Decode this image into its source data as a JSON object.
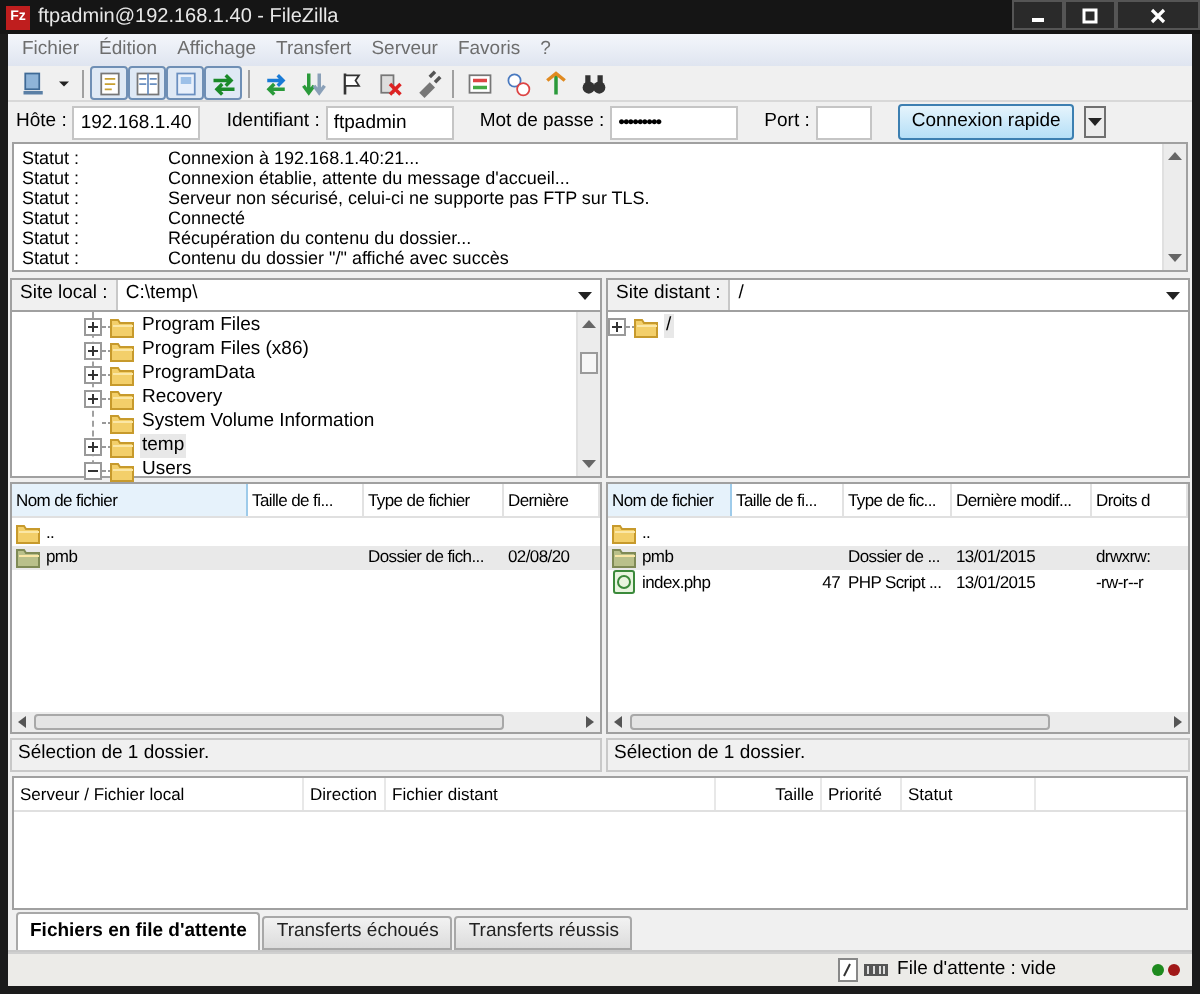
{
  "window": {
    "title": "ftpadmin@192.168.1.40 - FileZilla",
    "logo_text": "Fz"
  },
  "menu": [
    "Fichier",
    "Édition",
    "Affichage",
    "Transfert",
    "Serveur",
    "Favoris",
    "?"
  ],
  "toolbar": {
    "groups": [
      [
        {
          "kind": "site-manager",
          "on": false
        },
        {
          "kind": "caret",
          "on": false
        }
      ],
      [
        {
          "kind": "log",
          "on": true
        },
        {
          "kind": "local-tree",
          "on": true
        },
        {
          "kind": "remote-tree",
          "on": true
        },
        {
          "kind": "queue",
          "on": true
        }
      ],
      [
        {
          "kind": "refresh",
          "on": false
        },
        {
          "kind": "process",
          "on": false
        },
        {
          "kind": "cancel",
          "on": false
        },
        {
          "kind": "disconnect",
          "on": false
        },
        {
          "kind": "reconnect",
          "on": false
        }
      ],
      [
        {
          "kind": "filter",
          "on": false
        },
        {
          "kind": "compare",
          "on": false
        },
        {
          "kind": "sync",
          "on": false
        },
        {
          "kind": "search",
          "on": false
        }
      ]
    ]
  },
  "quickconnect": {
    "fields": [
      {
        "label": "Hôte :",
        "value": "192.168.1.40",
        "kind": "text"
      },
      {
        "label": "Identifiant :",
        "value": "ftpadmin",
        "kind": "text"
      },
      {
        "label": "Mot de passe :",
        "value": "•••••••••",
        "kind": "password"
      },
      {
        "label": "Port :",
        "kind": "port"
      }
    ],
    "button": "Connexion rapide"
  },
  "log": [
    {
      "label": "Statut :",
      "message": "Connexion à 192.168.1.40:21..."
    },
    {
      "label": "Statut :",
      "message": "Connexion établie, attente du message d'accueil..."
    },
    {
      "label": "Statut :",
      "message": "Serveur non sécurisé, celui-ci ne supporte pas FTP sur TLS."
    },
    {
      "label": "Statut :",
      "message": "Connecté"
    },
    {
      "label": "Statut :",
      "message": "Récupération du contenu du dossier..."
    },
    {
      "label": "Statut :",
      "message": "Contenu du dossier \"/\" affiché avec succès"
    }
  ],
  "local": {
    "site_label": "Site local :",
    "path": "C:\\temp\\",
    "tree": [
      {
        "label": "Program Files",
        "has_children": true,
        "expanded": false,
        "selected": false
      },
      {
        "label": "Program Files (x86)",
        "has_children": true,
        "expanded": false,
        "selected": false
      },
      {
        "label": "ProgramData",
        "has_children": true,
        "expanded": false,
        "selected": false
      },
      {
        "label": "Recovery",
        "has_children": true,
        "expanded": false,
        "selected": false
      },
      {
        "label": "System Volume Information",
        "has_children": false,
        "selected": false
      },
      {
        "label": "temp",
        "has_children": true,
        "expanded": false,
        "selected": true
      },
      {
        "label": "Users",
        "has_children": true,
        "expanded": true,
        "selected": false
      }
    ],
    "columns": [
      "Nom de fichier",
      "Taille de fi...",
      "Type de fichier",
      "Dernière"
    ],
    "rows": [
      {
        "kind": "parent",
        "cells": [
          ".."
        ],
        "selected": false
      },
      {
        "kind": "folder",
        "cells": [
          "pmb",
          "",
          "Dossier de fich...",
          "02/08/20"
        ],
        "selected": true
      }
    ],
    "status": "Sélection de 1 dossier."
  },
  "remote": {
    "site_label": "Site distant :",
    "path": "/",
    "tree": [
      {
        "label": "/",
        "has_children": true,
        "expanded": false,
        "selected": true
      }
    ],
    "columns": [
      "Nom de fichier",
      "Taille de fi...",
      "Type de fic...",
      "Dernière modif...",
      "Droits d"
    ],
    "rows": [
      {
        "kind": "parent",
        "cells": [
          ".."
        ],
        "selected": false
      },
      {
        "kind": "folder",
        "cells": [
          "pmb",
          "",
          "Dossier de ...",
          "13/01/2015",
          "drwxrw:"
        ],
        "selected": true
      },
      {
        "kind": "php",
        "cells": [
          "index.php",
          "47",
          "PHP Script ...",
          "13/01/2015",
          "-rw-r--r"
        ],
        "selected": false
      }
    ],
    "status": "Sélection de 1 dossier."
  },
  "queue": {
    "columns": [
      "Serveur / Fichier local",
      "Direction",
      "Fichier distant",
      "Taille",
      "Priorité",
      "Statut"
    ]
  },
  "tabs": [
    {
      "label": "Fichiers en file d'attente",
      "selected": true
    },
    {
      "label": "Transferts échoués",
      "selected": false
    },
    {
      "label": "Transferts réussis",
      "selected": false
    }
  ],
  "status_bar": {
    "queue": "File d'attente : vide",
    "lights": [
      {
        "color": "#1e8a1e"
      },
      {
        "color": "#a01818"
      }
    ]
  }
}
